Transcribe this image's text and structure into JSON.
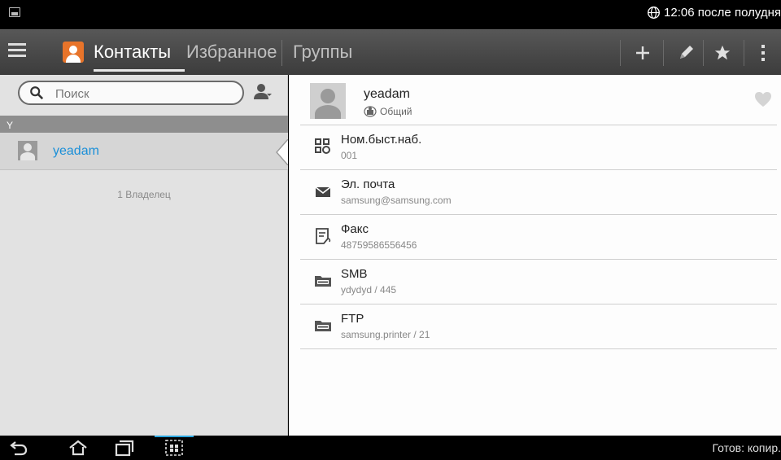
{
  "status_bar": {
    "time": "12:06 после полудня"
  },
  "action_bar": {
    "tabs": [
      {
        "label": "Контакты"
      },
      {
        "label": "Избранное"
      },
      {
        "label": "Группы"
      }
    ],
    "actions": [
      "add-icon",
      "edit-icon",
      "star-icon",
      "overflow-menu-icon"
    ]
  },
  "contact_list": {
    "search_placeholder": "Поиск",
    "section_letter": "Y",
    "contacts": [
      {
        "name": "yeadam"
      }
    ],
    "owner_count": "1 Владелец"
  },
  "contact_detail": {
    "name": "yeadam",
    "visibility": "Общий",
    "fields": [
      {
        "label": "Ном.быст.наб.",
        "value": "001",
        "icon": "speed-dial-icon"
      },
      {
        "label": "Эл. почта",
        "value": "samsung@samsung.com",
        "icon": "email-icon"
      },
      {
        "label": "Факс",
        "value": "48759586556456",
        "icon": "fax-icon"
      },
      {
        "label": "SMB",
        "value": "ydydyd / 445",
        "icon": "smb-folder-icon"
      },
      {
        "label": "FTP",
        "value": "samsung.printer / 21",
        "icon": "ftp-folder-icon"
      }
    ]
  },
  "nav_bar": {
    "status_text": "Готов: копир."
  },
  "colors": {
    "accent_blue": "#1a8fd8",
    "contacts_icon": "#e8742a",
    "action_bar": "#4a4a4a"
  }
}
